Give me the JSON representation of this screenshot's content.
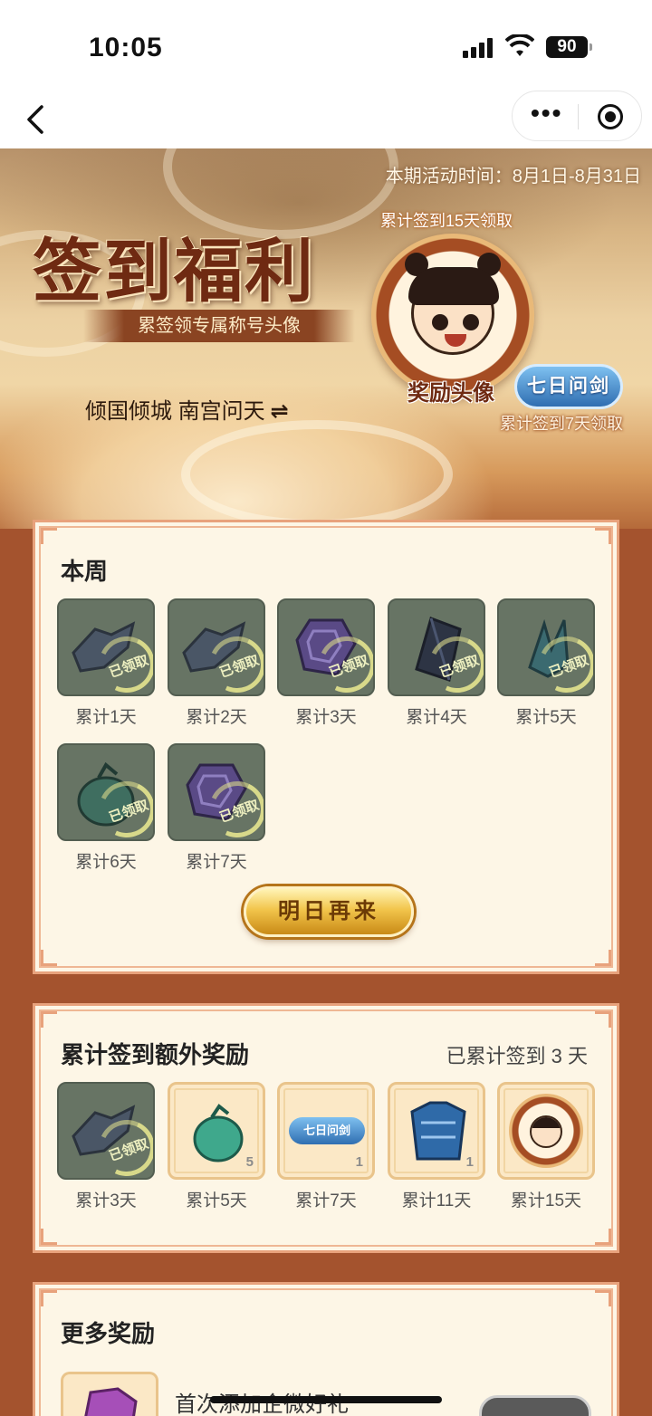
{
  "status_bar": {
    "time": "10:05",
    "battery": "90"
  },
  "nav": {
    "back_icon": "chevron-left-icon",
    "more_icon": "more-dots-icon",
    "close_icon": "target-icon"
  },
  "banner": {
    "period": "本期活动时间：8月1日-8月31日",
    "title": "签到福利",
    "subtitle": "累签领专属称号头像",
    "user_title": "倾国倾城 南宫问天",
    "swap_icon": "⇌",
    "avatar_top_label": "累计签到15天领取",
    "avatar_caption": "奖励头像",
    "badge": "七日问剑",
    "badge_caption": "累计签到7天领取"
  },
  "weekly": {
    "title": "本周",
    "stamp_label": "已领取",
    "items": [
      {
        "label": "累计1天",
        "icon": "gauntlet-icon",
        "claimed": true
      },
      {
        "label": "累计2天",
        "icon": "gauntlet-icon",
        "claimed": true
      },
      {
        "label": "累计3天",
        "icon": "purple-gem-icon",
        "claimed": true
      },
      {
        "label": "累计4天",
        "icon": "dark-crystal-icon",
        "claimed": true
      },
      {
        "label": "累计5天",
        "icon": "teal-crystal-icon",
        "claimed": true
      },
      {
        "label": "累计6天",
        "icon": "herb-pouch-icon",
        "claimed": true
      },
      {
        "label": "累计7天",
        "icon": "purple-gem-icon",
        "claimed": true
      }
    ],
    "button": "明日再来"
  },
  "cumulative": {
    "title": "累计签到额外奖励",
    "progress": "已累计签到 3 天",
    "items": [
      {
        "label": "累计3天",
        "icon": "gauntlet-icon",
        "claimed": true,
        "count": ""
      },
      {
        "label": "累计5天",
        "icon": "herb-pouch-icon",
        "claimed": false,
        "count": "5"
      },
      {
        "label": "累计7天",
        "icon": "title-badge-icon",
        "claimed": false,
        "count": "1",
        "badge_text": "七日问剑"
      },
      {
        "label": "累计11天",
        "icon": "armor-icon",
        "claimed": false,
        "count": "1"
      },
      {
        "label": "累计15天",
        "icon": "avatar-frame-icon",
        "claimed": false,
        "count": ""
      }
    ]
  },
  "more": {
    "title": "更多奖励",
    "first_item": "首次添加企微好礼"
  },
  "colors": {
    "panel_border": "#e8a27c",
    "panel_bg": "#fdf6e6",
    "claimed_tile": "#677464",
    "gold_button": "#f2c54c"
  }
}
